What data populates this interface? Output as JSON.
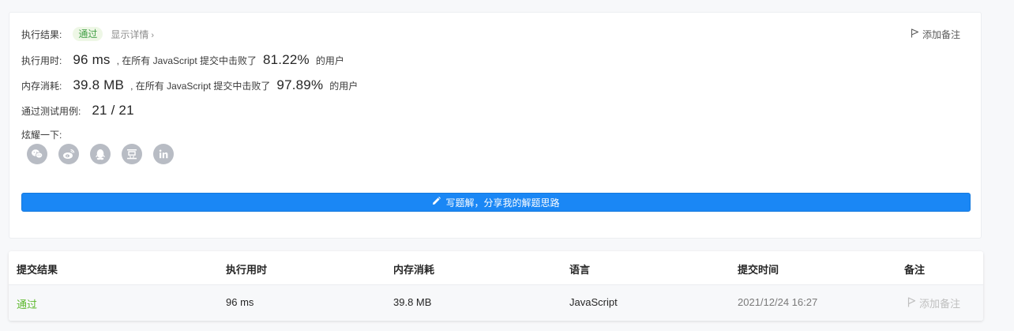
{
  "result": {
    "status_label": "执行结果:",
    "status_value": "通过",
    "details_link": "显示详情",
    "add_note": "添加备注",
    "runtime": {
      "label": "执行用时:",
      "value": "96 ms",
      "mid_text": ", 在所有 JavaScript 提交中击败了",
      "percent": "81.22%",
      "suffix": "的用户"
    },
    "memory": {
      "label": "内存消耗:",
      "value": "39.8 MB",
      "mid_text": ", 在所有 JavaScript 提交中击败了",
      "percent": "97.89%",
      "suffix": "的用户"
    },
    "testcases": {
      "label": "通过测试用例:",
      "value": "21 / 21"
    },
    "share": {
      "label": "炫耀一下:",
      "icons": [
        "wechat-icon",
        "weibo-icon",
        "qq-icon",
        "douban-icon",
        "linkedin-icon"
      ]
    },
    "write_solution_label": "写题解，分享我的解题思路"
  },
  "submissions": {
    "headers": [
      "提交结果",
      "执行用时",
      "内存消耗",
      "语言",
      "提交时间",
      "备注"
    ],
    "rows": [
      {
        "status": "通过",
        "runtime": "96 ms",
        "memory": "39.8 MB",
        "language": "JavaScript",
        "time": "2021/12/24 16:27",
        "note": "添加备注"
      }
    ]
  },
  "colors": {
    "primary": "#1a87f5",
    "success": "#5cb82b",
    "badge_bg": "#eef7e6",
    "icon_gray": "#b8bcc4"
  }
}
